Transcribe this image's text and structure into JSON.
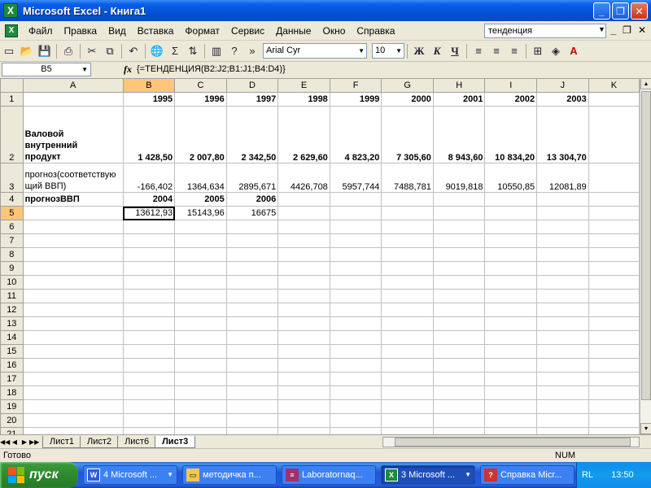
{
  "window": {
    "title": "Microsoft Excel - Книга1"
  },
  "menu": [
    "Файл",
    "Правка",
    "Вид",
    "Вставка",
    "Формат",
    "Сервис",
    "Данные",
    "Окно",
    "Справка"
  ],
  "help_search": "тенденция",
  "toolbar": {
    "font": "Arial Cyr",
    "size": "10",
    "bold": "Ж",
    "italic": "К",
    "underline": "Ч"
  },
  "formula_bar": {
    "cell": "B5",
    "fx": "fx",
    "formula": "{=ТЕНДЕНЦИЯ(B2:J2;B1:J1;B4:D4)}"
  },
  "columns": [
    "A",
    "B",
    "C",
    "D",
    "E",
    "F",
    "G",
    "H",
    "I",
    "J",
    "K"
  ],
  "rows": {
    "r1": [
      "",
      "1995",
      "1996",
      "1997",
      "1998",
      "1999",
      "2000",
      "2001",
      "2002",
      "2003",
      ""
    ],
    "r2": [
      "Валовой внутренний продукт",
      "1 428,50",
      "2 007,80",
      "2 342,50",
      "2 629,60",
      "4 823,20",
      "7 305,60",
      "8 943,60",
      "10 834,20",
      "13 304,70",
      ""
    ],
    "r3": [
      "прогноз(соответствующий ВВП)",
      "-166,402",
      "1364,634",
      "2895,671",
      "4426,708",
      "5957,744",
      "7488,781",
      "9019,818",
      "10550,85",
      "12081,89",
      ""
    ],
    "r4": [
      "прогнозВВП",
      "2004",
      "2005",
      "2006",
      "",
      "",
      "",
      "",
      "",
      "",
      ""
    ],
    "r5": [
      "",
      "13612,93",
      "15143,96",
      "16675",
      "",
      "",
      "",
      "",
      "",
      "",
      ""
    ]
  },
  "row_numbers": [
    "1",
    "2",
    "3",
    "4",
    "5",
    "6",
    "7",
    "8",
    "9",
    "10",
    "11",
    "12",
    "13",
    "14",
    "15",
    "16",
    "17",
    "18",
    "19",
    "20",
    "21"
  ],
  "sheet_tabs": [
    "Лист1",
    "Лист2",
    "Лист6",
    "Лист3"
  ],
  "status": {
    "left": "Готово",
    "num": "NUM"
  },
  "taskbar": {
    "start": "пуск",
    "items": [
      "4 Microsoft ...",
      "методичка п...",
      "Laboratornaq...",
      "3 Microsoft ...",
      "Справка Micr..."
    ],
    "lang": "RL",
    "clock": "13:50"
  }
}
